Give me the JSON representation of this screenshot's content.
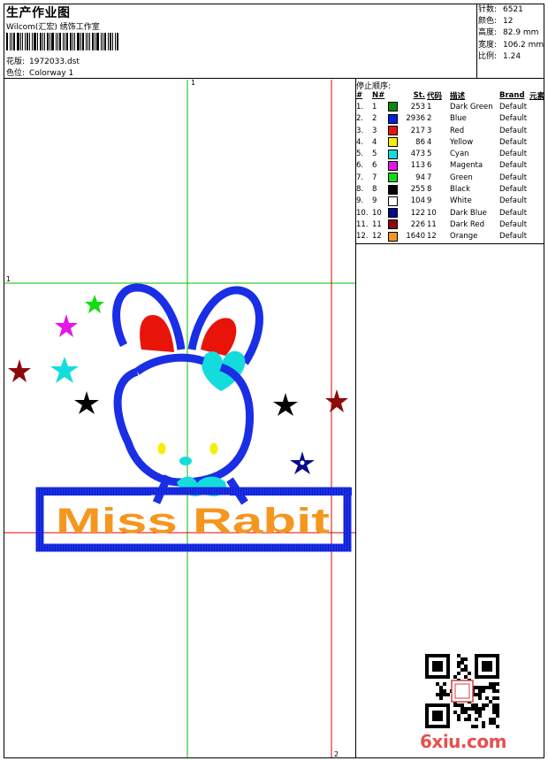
{
  "header": {
    "title": "生产作业图",
    "company": "Wilcom(汇宏) 绣饰工作室",
    "design_label": "花版:",
    "design_value": "1972033.dst",
    "colorway_label": "色位:",
    "colorway_value": "Colorway 1"
  },
  "stats": [
    {
      "label": "针数:",
      "value": "6521"
    },
    {
      "label": "颜色:",
      "value": "12"
    },
    {
      "label": "高度:",
      "value": "82.9 mm"
    },
    {
      "label": "宽度:",
      "value": "106.2 mm"
    },
    {
      "label": "比例:",
      "value": "1.24"
    }
  ],
  "stop_sequence": {
    "title": "停止顺序:",
    "headers": [
      "#",
      "N#",
      "St.",
      "代码",
      "描述",
      "Brand",
      "元素"
    ],
    "rows": [
      {
        "idx": "1.",
        "n": "1",
        "st": "253",
        "code": "1",
        "desc": "Dark Green",
        "brand": "Default",
        "color": "#0a8a0a"
      },
      {
        "idx": "2.",
        "n": "2",
        "st": "2936",
        "code": "2",
        "desc": "Blue",
        "brand": "Default",
        "color": "#0a1edc"
      },
      {
        "idx": "3.",
        "n": "3",
        "st": "217",
        "code": "3",
        "desc": "Red",
        "brand": "Default",
        "color": "#e8140a"
      },
      {
        "idx": "4.",
        "n": "4",
        "st": "86",
        "code": "4",
        "desc": "Yellow",
        "brand": "Default",
        "color": "#f5f000"
      },
      {
        "idx": "5.",
        "n": "5",
        "st": "473",
        "code": "5",
        "desc": "Cyan",
        "brand": "Default",
        "color": "#14dcdc"
      },
      {
        "idx": "6.",
        "n": "6",
        "st": "113",
        "code": "6",
        "desc": "Magenta",
        "brand": "Default",
        "color": "#e614e6"
      },
      {
        "idx": "7.",
        "n": "7",
        "st": "94",
        "code": "7",
        "desc": "Green",
        "brand": "Default",
        "color": "#14dc14"
      },
      {
        "idx": "8.",
        "n": "8",
        "st": "255",
        "code": "8",
        "desc": "Black",
        "brand": "Default",
        "color": "#000000"
      },
      {
        "idx": "9.",
        "n": "9",
        "st": "104",
        "code": "9",
        "desc": "White",
        "brand": "Default",
        "color": "#ffffff"
      },
      {
        "idx": "10.",
        "n": "10",
        "st": "122",
        "code": "10",
        "desc": "Dark Blue",
        "brand": "Default",
        "color": "#0a0a8c"
      },
      {
        "idx": "11.",
        "n": "11",
        "st": "226",
        "code": "11",
        "desc": "Dark Red",
        "brand": "Default",
        "color": "#8c0a0a"
      },
      {
        "idx": "12.",
        "n": "12",
        "st": "1640",
        "code": "12",
        "desc": "Orange",
        "brand": "Default",
        "color": "#f5961e"
      }
    ]
  },
  "design": {
    "text": "Miss Rabit",
    "guide_labels": {
      "top": "1",
      "left": "1",
      "bottom": "2"
    }
  },
  "watermark": "6xiu.com"
}
